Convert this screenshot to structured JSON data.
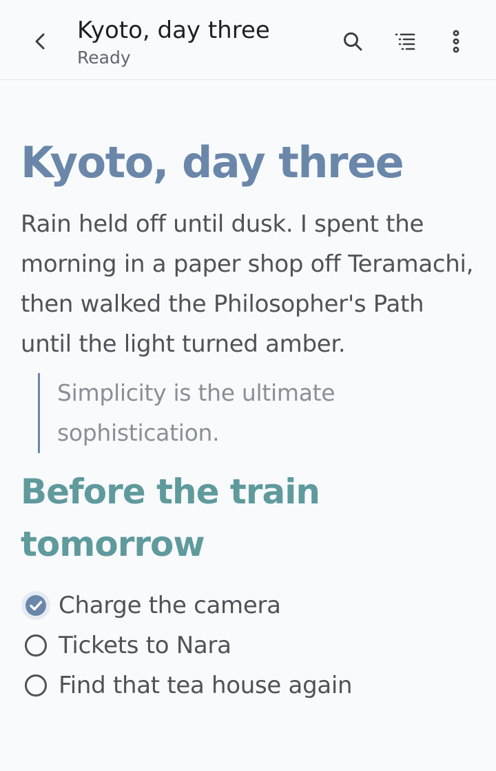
{
  "appbar": {
    "title": "Kyoto, day three",
    "status": "Ready",
    "icons": {
      "back": "chevron-left-icon",
      "search": "search-icon",
      "outline": "outline-list-icon",
      "more": "more-vertical-icon"
    }
  },
  "document": {
    "title": "Kyoto, day three",
    "paragraph": "Rain held off until dusk. I spent the morning in a paper shop off Teramachi, then walked the Philosopher's Path until the light turned amber.",
    "quote": "Simplicity is the ultimate sophistication.",
    "heading2": "Before the train tomorrow",
    "checklist": [
      {
        "label": "Charge the camera",
        "checked": true
      },
      {
        "label": "Tickets to Nara",
        "checked": false
      },
      {
        "label": "Find that tea house again",
        "checked": false
      }
    ]
  },
  "colors": {
    "title": "#6a87aa",
    "heading2": "#5f9a9c",
    "body_text": "#4f5256",
    "quote_text": "#8a8f96",
    "quote_bar": "#6a87aa",
    "checked": "#6a87aa",
    "background": "#f8fafc"
  }
}
